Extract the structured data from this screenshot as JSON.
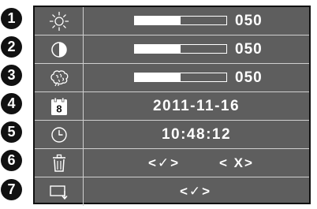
{
  "badges": [
    "1",
    "2",
    "3",
    "4",
    "5",
    "6",
    "7"
  ],
  "rows": {
    "brightness": {
      "icon": "sun-icon",
      "value": "050",
      "level_percent": 50
    },
    "contrast": {
      "icon": "contrast-icon",
      "value": "050",
      "level_percent": 50
    },
    "sharpness": {
      "icon": "brain-icon",
      "value": "050",
      "level_percent": 50
    },
    "date": {
      "icon": "calendar-icon",
      "calendar_day": "8",
      "value": "2011-11-16"
    },
    "time": {
      "icon": "clock-icon",
      "value": "10:48:12"
    },
    "delete": {
      "icon": "trash-icon",
      "confirm": "<✓>",
      "cancel": "< X>"
    },
    "exit": {
      "icon": "exit-icon",
      "confirm": "<✓>"
    }
  },
  "colors": {
    "panel_background": "#5e5e5e",
    "grid_lines": "#cfcfcf",
    "text": "#ffffff",
    "badge": "#111111"
  }
}
